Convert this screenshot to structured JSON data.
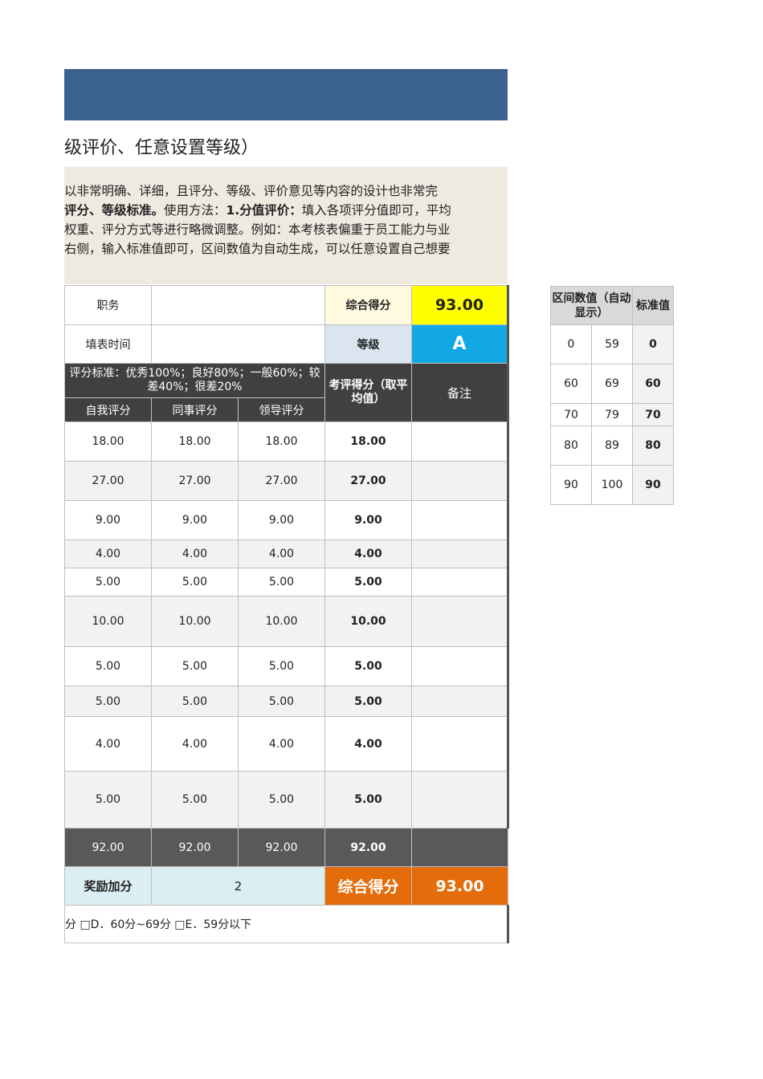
{
  "subtitle": "级评价、任意设置等级）",
  "description": {
    "line1": "以非常明确、详细，且评分、等级、评价意见等内容的设计也非常完",
    "line2_bold1": "评分、等级标准。",
    "line2_mid": "使用方法：",
    "line2_bold2": "1.分值评价：",
    "line2_rest": "填入各项评分值即可，平均",
    "line3": "权重、评分方式等进行略微调整。例如：本考核表偏重于员工能力与业",
    "line4": "右侧，输入标准值即可，区间数值为自动生成，可以任意设置自己想要"
  },
  "header": {
    "position_label": "职务",
    "position_value": "",
    "fill_time_label": "填表时间",
    "fill_time_value": "",
    "total_score_label": "综合得分",
    "total_score_value": "93.00",
    "grade_label": "等级",
    "grade_value": "A",
    "criteria_text": "评分标准：优秀100%；良好80%；一般60%；较差40%；很差20%",
    "avg_score_label": "考评得分（取平均值）",
    "remark_label": "备注",
    "self_label": "自我评分",
    "peer_label": "同事评分",
    "leader_label": "领导评分"
  },
  "rows": [
    {
      "self": "18.00",
      "peer": "18.00",
      "leader": "18.00",
      "avg": "18.00",
      "remark": ""
    },
    {
      "self": "27.00",
      "peer": "27.00",
      "leader": "27.00",
      "avg": "27.00",
      "remark": ""
    },
    {
      "self": "9.00",
      "peer": "9.00",
      "leader": "9.00",
      "avg": "9.00",
      "remark": ""
    },
    {
      "self": "4.00",
      "peer": "4.00",
      "leader": "4.00",
      "avg": "4.00",
      "remark": ""
    },
    {
      "self": "5.00",
      "peer": "5.00",
      "leader": "5.00",
      "avg": "5.00",
      "remark": ""
    },
    {
      "self": "10.00",
      "peer": "10.00",
      "leader": "10.00",
      "avg": "10.00",
      "remark": ""
    },
    {
      "self": "5.00",
      "peer": "5.00",
      "leader": "5.00",
      "avg": "5.00",
      "remark": ""
    },
    {
      "self": "5.00",
      "peer": "5.00",
      "leader": "5.00",
      "avg": "5.00",
      "remark": ""
    },
    {
      "self": "4.00",
      "peer": "4.00",
      "leader": "4.00",
      "avg": "4.00",
      "remark": ""
    },
    {
      "self": "5.00",
      "peer": "5.00",
      "leader": "5.00",
      "avg": "5.00",
      "remark": ""
    }
  ],
  "totals": {
    "self": "92.00",
    "peer": "92.00",
    "leader": "92.00",
    "avg": "92.00"
  },
  "bonus": {
    "label": "奖励加分",
    "value": "2",
    "total_label": "综合得分",
    "total_value": "93.00"
  },
  "grade_options_text": "分  □D．60分~69分  □E．59分以下",
  "side_table": {
    "range_header": "区间数值（自动显示）",
    "std_header": "标准值",
    "rows": [
      {
        "low": "0",
        "high": "59",
        "std": "0"
      },
      {
        "low": "60",
        "high": "69",
        "std": "60"
      },
      {
        "low": "70",
        "high": "79",
        "std": "70"
      },
      {
        "low": "80",
        "high": "89",
        "std": "80"
      },
      {
        "low": "90",
        "high": "100",
        "std": "90"
      }
    ]
  },
  "colors": {
    "banner": "#3b6290",
    "grade_cell": "#12a8e4",
    "score_cell": "#ffff00",
    "bonus_total": "#e46c0a",
    "dark_header": "#404040"
  }
}
